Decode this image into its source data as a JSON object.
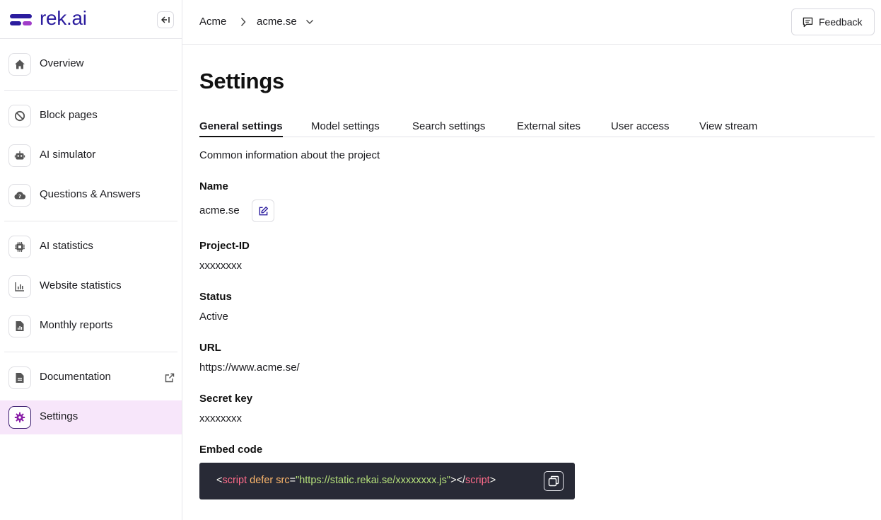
{
  "brand": {
    "name": "rek.ai",
    "colors": {
      "primary": "#2b1c9e",
      "accent": "#a03cc8"
    }
  },
  "sidebar": {
    "collapse_icon": "collapse-left-icon",
    "items": [
      {
        "label": "Overview",
        "icon": "home-icon"
      },
      {
        "label": "Block pages",
        "icon": "block-icon"
      },
      {
        "label": "AI simulator",
        "icon": "robot-icon"
      },
      {
        "label": "Questions & Answers",
        "icon": "cloud-question-icon"
      },
      {
        "label": "AI statistics",
        "icon": "chip-icon"
      },
      {
        "label": "Website statistics",
        "icon": "bar-chart-icon"
      },
      {
        "label": "Monthly reports",
        "icon": "report-icon"
      },
      {
        "label": "Documentation",
        "icon": "document-icon",
        "external": true
      },
      {
        "label": "Settings",
        "icon": "gear-icon",
        "active": true
      }
    ]
  },
  "header": {
    "breadcrumb_root": "Acme",
    "breadcrumb_current": "acme.se",
    "feedback_label": "Feedback"
  },
  "main": {
    "title": "Settings",
    "tabs": [
      {
        "label": "General settings",
        "active": true
      },
      {
        "label": "Model settings"
      },
      {
        "label": "Search settings"
      },
      {
        "label": "External sites"
      },
      {
        "label": "User access"
      },
      {
        "label": "View stream"
      }
    ],
    "subtitle": "Common information about the project",
    "fields": {
      "name": {
        "label": "Name",
        "value": "acme.se"
      },
      "project_id": {
        "label": "Project-ID",
        "value": "xxxxxxxx"
      },
      "status": {
        "label": "Status",
        "value": "Active"
      },
      "url": {
        "label": "URL",
        "value": "https://www.acme.se/"
      },
      "secret_key": {
        "label": "Secret key",
        "value": "xxxxxxxx"
      },
      "embed_code": {
        "label": "Embed code",
        "lt": "<",
        "tag_open": "script",
        "attr_defer": "defer",
        "attr_src": "src",
        "eq": "=",
        "src_value": "\"https://static.rekai.se/xxxxxxxx.js\"",
        "gt_close": "></",
        "tag_close": "script",
        "gt": ">"
      }
    }
  }
}
